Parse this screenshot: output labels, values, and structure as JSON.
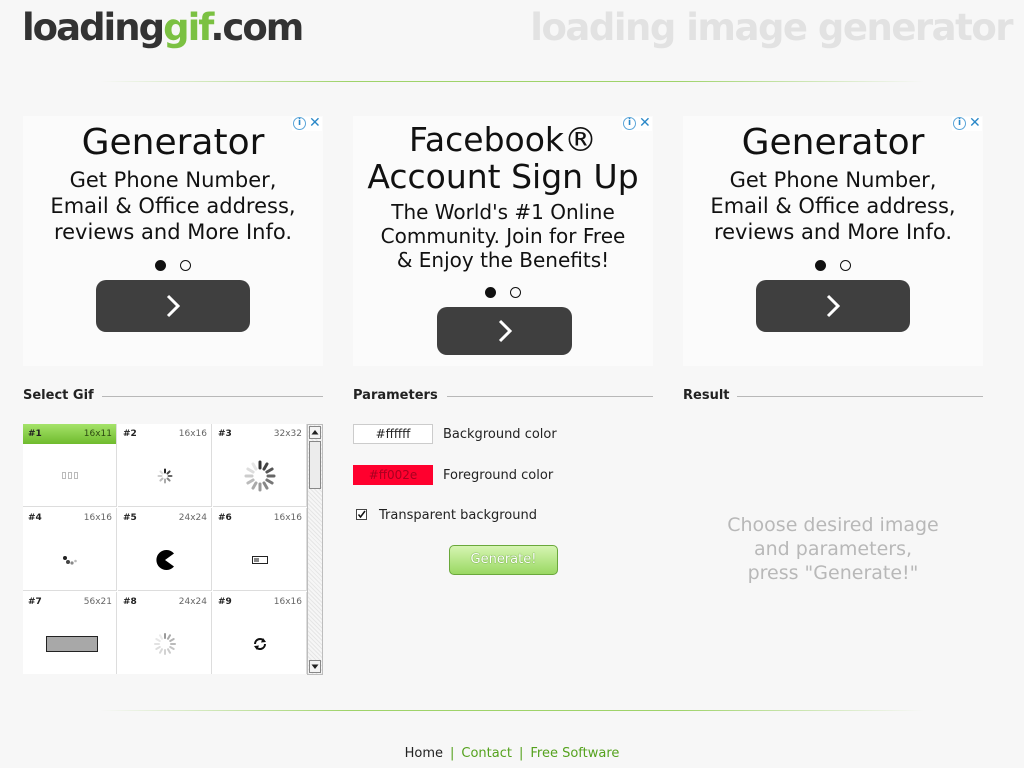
{
  "header": {
    "logo_part1": "loading",
    "logo_part2": "gif",
    "logo_part3": ".com",
    "tagline": "loading image generator"
  },
  "ads": [
    {
      "title": "Generator",
      "lines": [
        "Get Phone Number,",
        "Email & Office address,",
        "reviews and More Info."
      ]
    },
    {
      "title_lines": [
        "Facebook®",
        "Account Sign Up"
      ],
      "lines": [
        "The World's #1 Online",
        "Community. Join for Free",
        "& Enjoy the Benefits!"
      ]
    },
    {
      "title": "Generator",
      "lines": [
        "Get Phone Number,",
        "Email & Office address,",
        "reviews and More Info."
      ]
    }
  ],
  "select_gif": {
    "heading": "Select Gif",
    "items": [
      {
        "num": "#1",
        "size": "16x11",
        "icon": "bars-icon",
        "selected": true
      },
      {
        "num": "#2",
        "size": "16x16",
        "icon": "small-spinner-icon"
      },
      {
        "num": "#3",
        "size": "32x32",
        "icon": "spinner-icon"
      },
      {
        "num": "#4",
        "size": "16x16",
        "icon": "dots-arc-icon"
      },
      {
        "num": "#5",
        "size": "24x24",
        "icon": "pacman-icon"
      },
      {
        "num": "#6",
        "size": "16x16",
        "icon": "progress-bar-icon"
      },
      {
        "num": "#7",
        "size": "56x21",
        "icon": "wide-bar-icon"
      },
      {
        "num": "#8",
        "size": "24x24",
        "icon": "light-spinner-icon"
      },
      {
        "num": "#9",
        "size": "16x16",
        "icon": "refresh-arrows-icon"
      }
    ]
  },
  "parameters": {
    "heading": "Parameters",
    "bg_value": "#ffffff",
    "bg_label": "Background color",
    "fg_value": "#ff002e",
    "fg_label": "Foreground color",
    "transparent_label": "Transparent background",
    "transparent_checked": true,
    "generate_label": "Generate!"
  },
  "result": {
    "heading": "Result",
    "lines": [
      "Choose desired image",
      "and parameters,",
      "press \"Generate!\""
    ]
  },
  "footer": {
    "home": "Home",
    "contact": "Contact",
    "free_software": "Free Software",
    "separator": "|"
  },
  "colors": {
    "accent_green": "#7bc142",
    "foreground_swatch": "#ff002e",
    "ad_button": "#3f3f3f"
  }
}
